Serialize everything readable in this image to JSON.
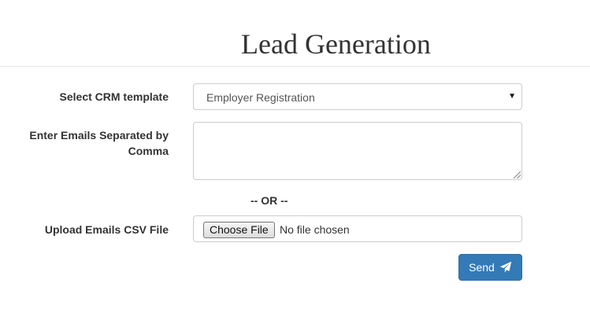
{
  "header": {
    "title": "Lead Generation"
  },
  "form": {
    "crm_label": "Select CRM template",
    "crm_selected": "Employer Registration",
    "emails_label": "Enter Emails Separated by Comma",
    "emails_value": "",
    "separator": "-- OR --",
    "upload_label": "Upload Emails CSV File",
    "file_button": "Choose File",
    "file_status": "No file chosen",
    "send_label": "Send",
    "send_icon": "paper-plane-icon",
    "select_icon": "caret-down-icon"
  },
  "colors": {
    "primary": "#337ab7",
    "border": "#cccccc",
    "text": "#333333"
  }
}
